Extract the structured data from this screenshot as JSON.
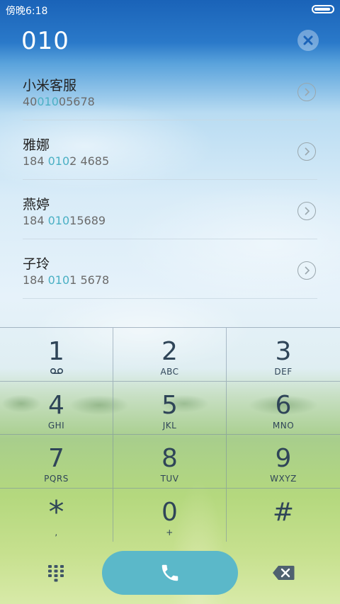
{
  "status_bar": {
    "time": "傍晚6:18",
    "battery_level": 0.9
  },
  "dialer": {
    "number": "010"
  },
  "contacts": [
    {
      "name": "小米客服",
      "number_prefix": "40",
      "number_match": "010",
      "number_suffix": "05678"
    },
    {
      "name": "雅娜",
      "number_prefix": "184 ",
      "number_match": "010",
      "number_suffix": "2 4685"
    },
    {
      "name": "燕婷",
      "number_prefix": "184 ",
      "number_match": "010",
      "number_suffix": "15689"
    },
    {
      "name": "子玲",
      "number_prefix": "184 ",
      "number_match": "010",
      "number_suffix": "1 5678"
    }
  ],
  "keypad": {
    "keys": [
      {
        "digit": "1",
        "letters": ""
      },
      {
        "digit": "2",
        "letters": "ABC"
      },
      {
        "digit": "3",
        "letters": "DEF"
      },
      {
        "digit": "4",
        "letters": "GHI"
      },
      {
        "digit": "5",
        "letters": "JKL"
      },
      {
        "digit": "6",
        "letters": "MNO"
      },
      {
        "digit": "7",
        "letters": "PQRS"
      },
      {
        "digit": "8",
        "letters": "TUV"
      },
      {
        "digit": "9",
        "letters": "WXYZ"
      },
      {
        "digit": "*",
        "letters": ","
      },
      {
        "digit": "0",
        "letters": "+"
      },
      {
        "digit": "#",
        "letters": ""
      }
    ]
  },
  "colors": {
    "accent": "#5bb8c9",
    "highlight": "#4ab0c4",
    "key_text": "#2f4558"
  },
  "icons": {
    "clear": "close-circle-icon",
    "detail": "chevron-right-circle-icon",
    "voicemail": "voicemail-icon",
    "keypad_toggle": "dialpad-icon",
    "call": "phone-icon",
    "backspace": "backspace-icon"
  }
}
